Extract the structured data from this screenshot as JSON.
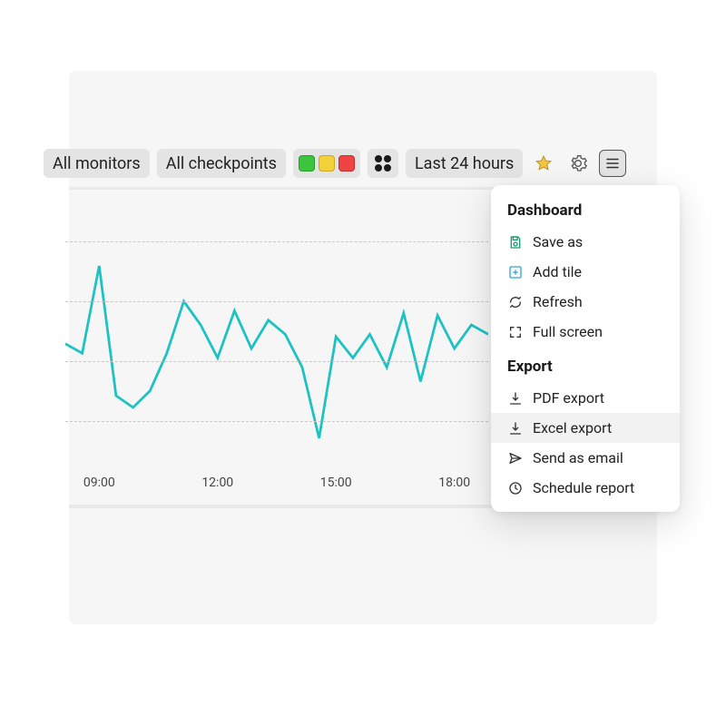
{
  "toolbar": {
    "monitors_label": "All monitors",
    "checkpoints_label": "All checkpoints",
    "timerange_label": "Last 24 hours"
  },
  "dropdown": {
    "section1_title": "Dashboard",
    "save_as": "Save as",
    "add_tile": "Add tile",
    "refresh": "Refresh",
    "full_screen": "Full screen",
    "section2_title": "Export",
    "pdf_export": "PDF export",
    "excel_export": "Excel export",
    "send_email": "Send as email",
    "schedule_report": "Schedule report"
  },
  "chart_data": {
    "type": "line",
    "title": "",
    "xlabel": "",
    "ylabel": "",
    "ylim": [
      0,
      100
    ],
    "x_ticks": [
      "09:00",
      "12:00",
      "15:00",
      "18:00"
    ],
    "x": [
      "08:00",
      "08:30",
      "09:00",
      "09:30",
      "10:00",
      "10:30",
      "11:00",
      "11:30",
      "12:00",
      "12:30",
      "13:00",
      "13:30",
      "14:00",
      "14:30",
      "15:00",
      "15:30",
      "16:00",
      "16:30",
      "17:00",
      "17:30",
      "18:00",
      "18:30",
      "19:00",
      "19:30",
      "20:00",
      "20:30"
    ],
    "values": [
      52,
      48,
      85,
      30,
      25,
      32,
      48,
      70,
      60,
      46,
      66,
      50,
      62,
      56,
      42,
      12,
      55,
      46,
      56,
      42,
      65,
      36,
      64,
      50,
      60,
      56
    ],
    "color": "#1fc2c2"
  }
}
